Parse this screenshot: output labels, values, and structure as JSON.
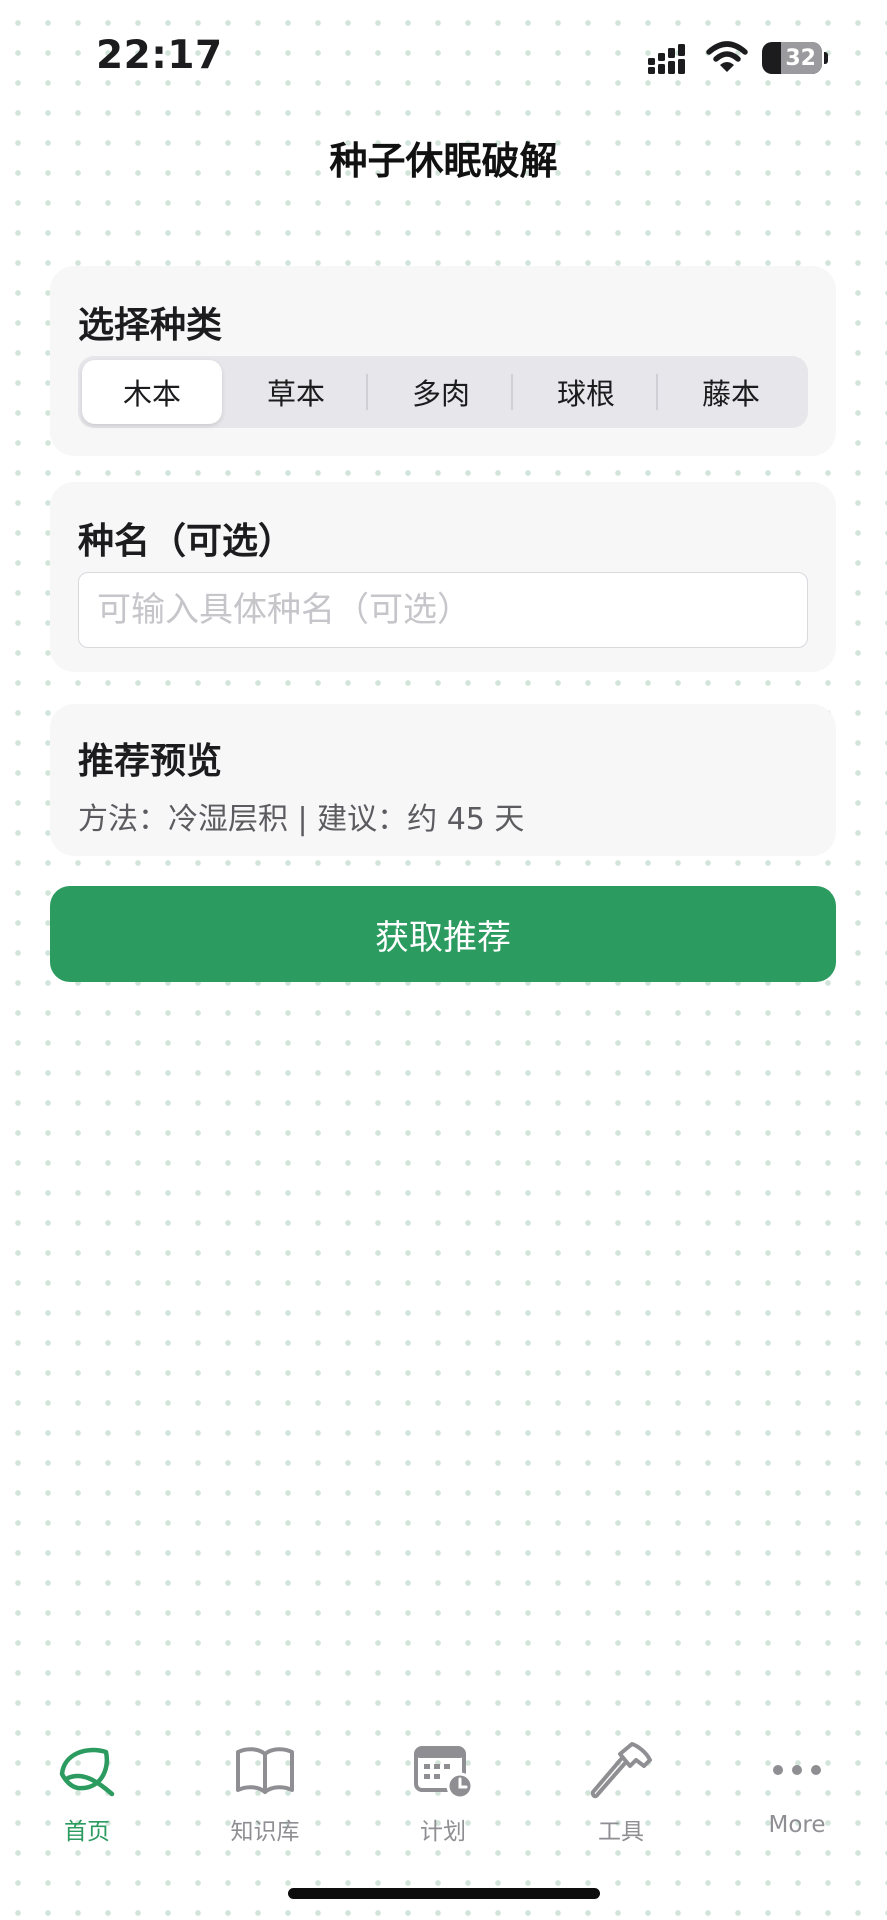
{
  "status_bar": {
    "time": "22:17",
    "battery_level": "32",
    "battery_fraction": 0.32
  },
  "header": {
    "title": "种子休眠破解"
  },
  "species_card": {
    "title": "选择种类",
    "options": [
      "木本",
      "草本",
      "多肉",
      "球根",
      "藤本"
    ],
    "selected_option": "木本"
  },
  "name_card": {
    "title": "种名（可选）",
    "placeholder": "可输入具体种名（可选）",
    "value": ""
  },
  "preview_card": {
    "title": "推荐预览",
    "text": "方法：冷湿层积 | 建议：约 45 天"
  },
  "action": {
    "label": "获取推荐"
  },
  "tab_bar": {
    "tabs": [
      {
        "label": "首页",
        "icon": "leaf-icon",
        "active": true
      },
      {
        "label": "知识库",
        "icon": "book-icon",
        "active": false
      },
      {
        "label": "计划",
        "icon": "calendar-clock-icon",
        "active": false
      },
      {
        "label": "工具",
        "icon": "hammer-icon",
        "active": false
      },
      {
        "label": "More",
        "icon": "more-icon",
        "active": false
      }
    ]
  },
  "colors": {
    "accent": "#2b9b5f",
    "inactive_tab": "#8e8e93",
    "card_background": "#f7f7f8",
    "dot_pattern": "#d3e4da"
  }
}
